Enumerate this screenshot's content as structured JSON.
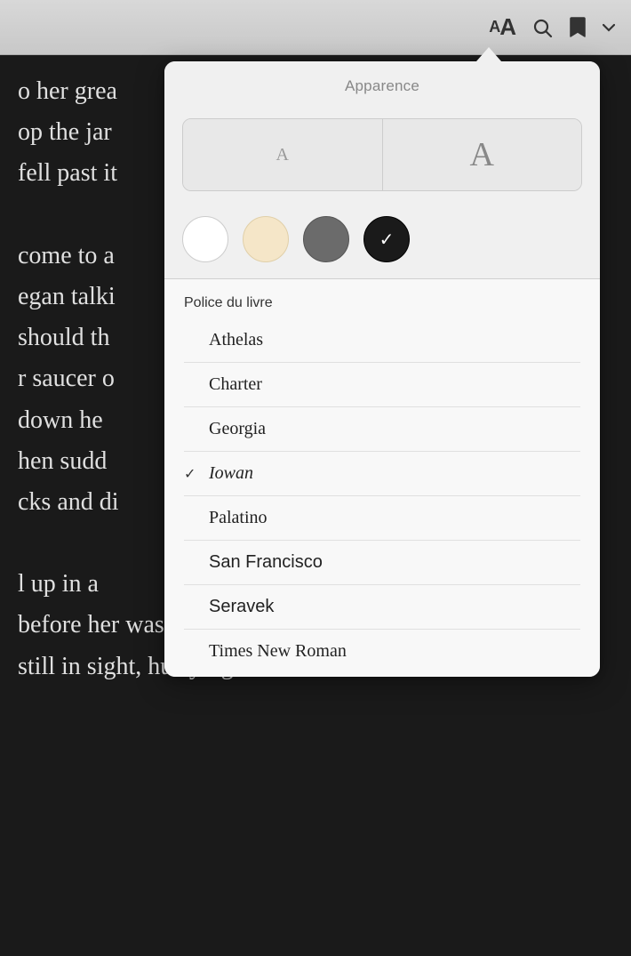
{
  "toolbar": {
    "font_small_label": "A",
    "font_large_label": "A",
    "search_icon": "search",
    "bookmark_icon": "bookmark",
    "chevron_icon": "chevron-down"
  },
  "popup": {
    "title": "Apparence",
    "font_size": {
      "small_label": "A",
      "large_label": "A"
    },
    "themes": [
      {
        "id": "white",
        "label": "White theme",
        "active": false
      },
      {
        "id": "sepia",
        "label": "Sepia theme",
        "active": false
      },
      {
        "id": "gray",
        "label": "Gray theme",
        "active": false
      },
      {
        "id": "black",
        "label": "Black theme",
        "active": true
      }
    ],
    "font_section_label": "Police du livre",
    "fonts": [
      {
        "name": "Athelas",
        "selected": false
      },
      {
        "name": "Charter",
        "selected": false
      },
      {
        "name": "Georgia",
        "selected": false
      },
      {
        "name": "Iowan",
        "selected": true
      },
      {
        "name": "Palatino",
        "selected": false
      },
      {
        "name": "San Francisco",
        "selected": false
      },
      {
        "name": "Seravek",
        "selected": false
      },
      {
        "name": "Times New Roman",
        "selected": false
      }
    ]
  },
  "book_text": {
    "line1": "o her grea",
    "line2": "op the jar",
    "line3": "fell past it",
    "line4": "",
    "line5": "come to a",
    "line6": "egan talki",
    "line7": "should th",
    "line8": "r saucer o",
    "line9": "down he",
    "line10": "hen sudd",
    "line11": "cks and di",
    "line12": "",
    "line13": "l up in a",
    "line14": "before her was another",
    "line15": "still in sight, hurrying"
  }
}
